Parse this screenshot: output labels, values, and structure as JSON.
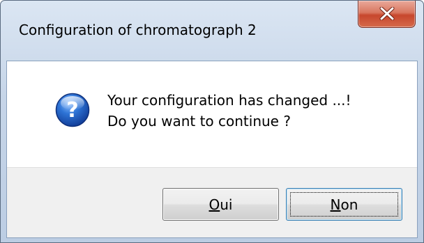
{
  "dialog": {
    "title": "Configuration of chromatograph 2",
    "close_icon": "close-icon",
    "message_icon": "question-icon",
    "message_line1": "Your configuration has changed ...!",
    "message_line2": "Do you want to continue ?",
    "buttons": {
      "oui": {
        "mnemonic": "O",
        "rest": "ui"
      },
      "non": {
        "mnemonic": "N",
        "rest": "on"
      }
    },
    "colors": {
      "close_button": "#c7472d",
      "icon_blue": "#1f5fbf",
      "default_button_border": "#3c7fb1"
    }
  }
}
